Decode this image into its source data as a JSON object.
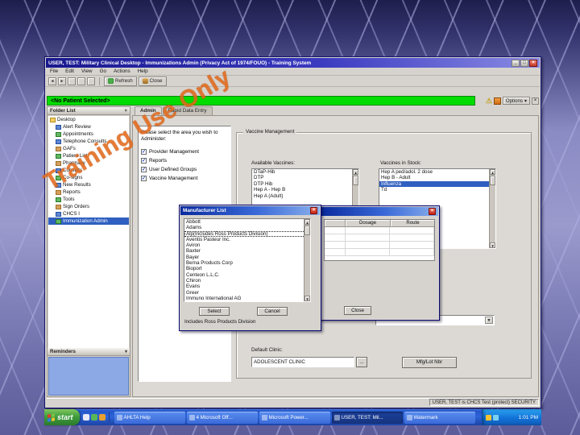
{
  "watermark": "Training Use Only",
  "window": {
    "title": "USER, TEST: Military Clinical Desktop - Immunizations Admin (Privacy Act of 1974/FOUO) -  Training System",
    "menu": [
      "File",
      "Edit",
      "View",
      "Go",
      "Actions",
      "Help"
    ],
    "toolbar": {
      "refresh": "Refresh",
      "close": "Close"
    },
    "patient_bar": {
      "text": "<No Patient Selected>",
      "options": "Options"
    },
    "status": "USER, TEST is CHCS Test (protect) SECURITY"
  },
  "sidebar": {
    "header": "Folder List",
    "items": [
      "Desktop",
      "Alert Review",
      "Appointments",
      "Telephone Consults",
      "GAFs",
      "Patient List",
      "Pharmacy",
      "Consults",
      "Co-signs",
      "New Results",
      "Reports",
      "Tools",
      "Sign Orders",
      "CHCS I",
      "Immunization Admin"
    ],
    "selected": "Immunization Admin",
    "reminders": "Reminders"
  },
  "content": {
    "tabs": [
      "Admin",
      "Rapid Data Entry"
    ],
    "active_tab": "Admin",
    "prompt": "Please select the area you wish to Administer:",
    "areas": [
      "Provider Management",
      "Reports",
      "User Defined Groups",
      "Vaccine Management"
    ],
    "group_title": "Vaccine Management",
    "available_label": "Available Vaccines:",
    "available": [
      "DTaP-Hib",
      "DTP",
      "DTP Hib",
      "Hep A - Hep B",
      "Hep A (Adult)"
    ],
    "stock_label": "Vaccines in Stock:",
    "stock": [
      "Hep A ped/adol. 2 dose",
      "Hep B - Adult",
      "Influenza",
      "Td"
    ],
    "stock_selected": "Influenza",
    "default_clinic_label": "Default Clinic:",
    "default_clinic_value": "ADOLESCENT CLINIC",
    "browse_label": "...",
    "mfg_button": "Mfg/Lot Nbr"
  },
  "stock_dialog": {
    "title": "",
    "headers": [
      "Dosage",
      "Route"
    ],
    "close_label": "Close"
  },
  "mfg_dialog": {
    "title": "Manufacturer List",
    "items": [
      "Abbott",
      "Adams",
      "Alp(Includes Ross Products Division)",
      "Aventis Pasteur Inc.",
      "Aviron",
      "Baxter",
      "Bayer",
      "Berna Products Corp",
      "Bioport",
      "Centeon L.L.C.",
      "Chiron",
      "Evans",
      "Greer",
      "Immuno International AG"
    ],
    "selected": "Alp(Includes Ross Products Division)",
    "select_label": "Select",
    "cancel_label": "Cancel",
    "footer": "Includes Ross Products Division"
  },
  "taskbar": {
    "start": "start",
    "tasks": [
      "AHLTA Help",
      "4 Microsoft Off...",
      "Microsoft Power...",
      "USER, TEST: Mil...",
      "Watermark"
    ],
    "active_task": "USER, TEST: Mil...",
    "time": "1:01 PM"
  }
}
